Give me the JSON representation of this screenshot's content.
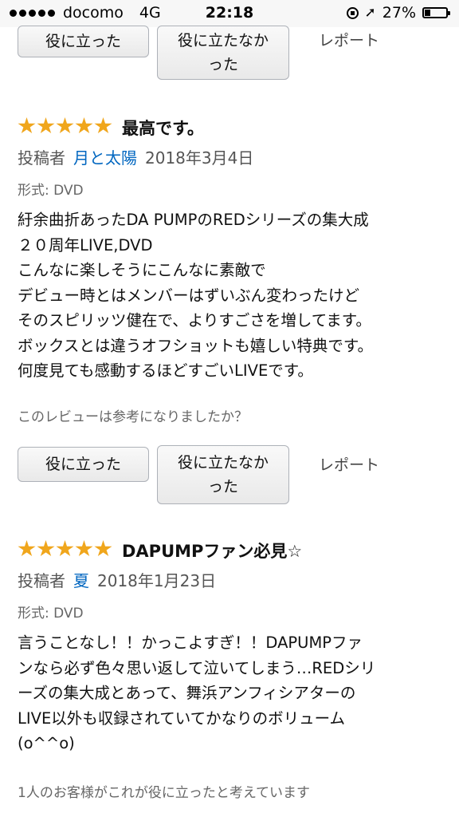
{
  "status_bar": {
    "carrier": "docomo",
    "network": "4G",
    "time": "22:18",
    "battery": "27%",
    "battery_level": 0.27
  },
  "top_buttons": {
    "helpful_label": "役に立った",
    "not_helpful_lines": [
      "役に立たなか",
      "った"
    ],
    "report_label": "レポート"
  },
  "reviews": [
    {
      "rating": 5,
      "title": "最高です。",
      "by_label": "投稿者",
      "author": "月と太陽",
      "date": "2018年3月4日",
      "format": "形式: DVD",
      "body_lines": [
        "紆余曲折あったDA PUMPのREDシリーズの集大成",
        "２０周年LIVE,DVD",
        "こんなに楽しそうにこんなに素敵で",
        "デビュー時とはメンバーはずいぶん変わったけど",
        "そのスピリッツ健在で、よりすごさを増してます。",
        "ボックスとは違うオフショットも嬉しい特典です。",
        "何度見ても感動するほどすごいLIVEです。"
      ],
      "helpful_prompt": "このレビューは参考になりましたか？",
      "helpful_label": "役に立った",
      "not_helpful_lines": [
        "役に立たなか",
        "った"
      ],
      "report_label": "レポート"
    },
    {
      "rating": 5,
      "title": "DAPUMPファン必見☆",
      "by_label": "投稿者",
      "author": "夏",
      "date": "2018年1月23日",
      "format": "形式: DVD",
      "body_lines": [
        "言うことなし！！かっこよすぎ！！DAPUMPファ",
        "ンなら必ず色々思い返して泣いてしまう…REDシリ",
        "ーズの集大成とあって、舞浜アンフィシアターの",
        "LIVE以外も収録されていてかなりのボリューム",
        "(o^^o)"
      ],
      "helpful_count_text": "1人のお客様がこれが役に立ったと考えています"
    }
  ]
}
